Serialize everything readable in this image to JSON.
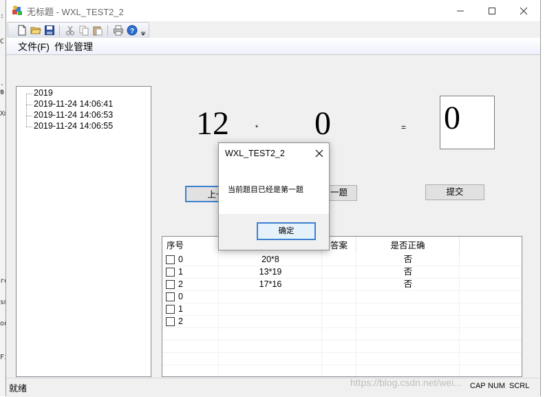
{
  "window": {
    "title": "无标题 - WXL_TEST2_2",
    "minimize_icon": "minimize-icon",
    "maximize_icon": "maximize-icon",
    "close_icon": "close-icon"
  },
  "toolbar": {
    "icons": [
      "new-file-icon",
      "open-folder-icon",
      "save-icon",
      "cut-icon",
      "copy-icon",
      "paste-icon",
      "print-icon",
      "help-icon"
    ]
  },
  "menu": {
    "items": [
      "文件(F)",
      "作业管理"
    ]
  },
  "tree": {
    "items": [
      "2019",
      "2019-11-24 14:06:41",
      "2019-11-24 14:06:53",
      "2019-11-24 14:06:55"
    ]
  },
  "problem": {
    "operand1": "12",
    "operator": "*",
    "operand2": "0",
    "equals": "=",
    "answer": "0"
  },
  "buttons": {
    "prev": "上一",
    "next": "一题",
    "submit": "提交"
  },
  "table": {
    "columns": [
      "序号",
      "",
      "答案",
      "是否正确"
    ],
    "rows": [
      {
        "index": "0",
        "expression": "20*8",
        "answer": "",
        "correct": "否"
      },
      {
        "index": "1",
        "expression": "13*19",
        "answer": "",
        "correct": "否"
      },
      {
        "index": "2",
        "expression": "17*16",
        "answer": "",
        "correct": "否"
      },
      {
        "index": "0",
        "expression": "",
        "answer": "",
        "correct": ""
      },
      {
        "index": "1",
        "expression": "",
        "answer": "",
        "correct": ""
      },
      {
        "index": "2",
        "expression": "",
        "answer": "",
        "correct": ""
      }
    ]
  },
  "status": {
    "text": "就绪",
    "indicators": [
      "CAP",
      "NUM",
      "SCRL"
    ],
    "watermark": "https://blog.csdn.net/wei..."
  },
  "dialog": {
    "title": "WXL_TEST2_2",
    "message": "当前题目已经是第一题",
    "ok_label": "确定"
  }
}
